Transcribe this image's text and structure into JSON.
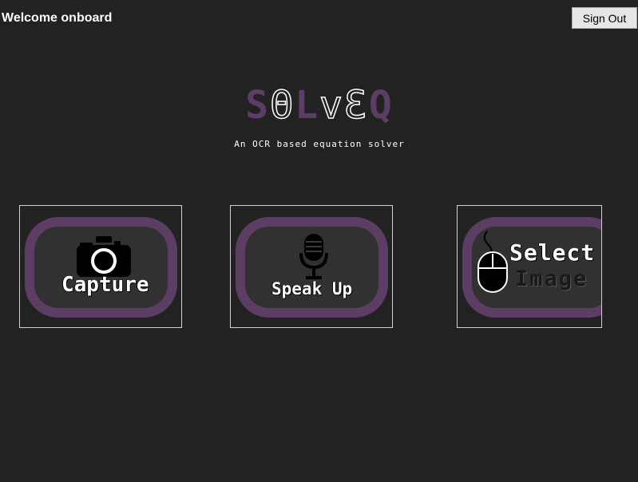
{
  "header": {
    "welcome": "Welcome onboard",
    "sign_out_label": "Sign Out"
  },
  "logo": {
    "letters": [
      "S",
      "Θ",
      "L",
      "v",
      "Ɛ",
      "Q"
    ],
    "subtitle": "An OCR based equation solver"
  },
  "actions": [
    {
      "label": "Capture",
      "icon": "camera-icon"
    },
    {
      "label": "Speak Up",
      "icon": "microphone-icon"
    },
    {
      "label_line1": "Select",
      "label_line2": "Image",
      "icon": "mouse-icon"
    }
  ],
  "colors": {
    "background": "#222222",
    "accent_purple": "#5c3d63",
    "pill_fill": "#313131"
  }
}
